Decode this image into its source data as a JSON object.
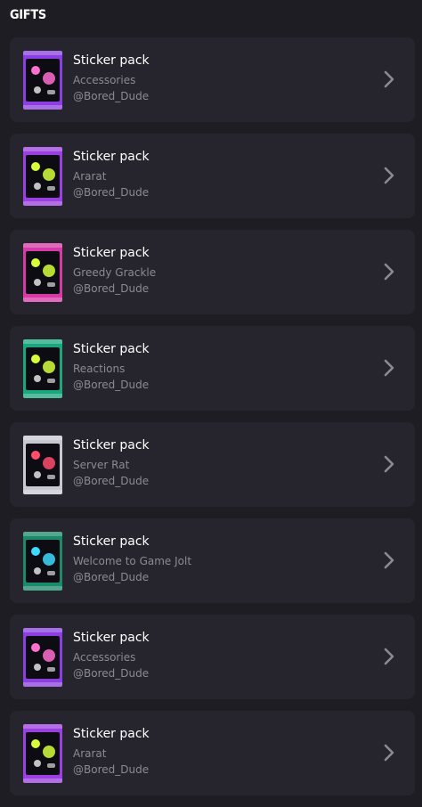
{
  "header": {
    "title": "GIFTS"
  },
  "gifts": [
    {
      "title": "Sticker pack",
      "pack": "Accessories",
      "owner": "@Bored_Dude",
      "color": "#8c3fe0",
      "accent": "#ff6fd0",
      "icon": "accessories-pack-icon"
    },
    {
      "title": "Sticker pack",
      "pack": "Ararat",
      "owner": "@Bored_Dude",
      "color": "#9b3fe0",
      "accent": "#d7ff3c",
      "icon": "ararat-pack-icon"
    },
    {
      "title": "Sticker pack",
      "pack": "Greedy Grackle",
      "owner": "@Bored_Dude",
      "color": "#d63aa7",
      "accent": "#d7ff3c",
      "icon": "greedy-grackle-pack-icon"
    },
    {
      "title": "Sticker pack",
      "pack": "Reactions",
      "owner": "@Bored_Dude",
      "color": "#1aa77d",
      "accent": "#d7ff3c",
      "icon": "reactions-pack-icon"
    },
    {
      "title": "Sticker pack",
      "pack": "Server Rat",
      "owner": "@Bored_Dude",
      "color": "#c8c8d2",
      "accent": "#ff4d6d",
      "icon": "server-rat-pack-icon"
    },
    {
      "title": "Sticker pack",
      "pack": "Welcome to Game Jolt",
      "owner": "@Bored_Dude",
      "color": "#1a8a6a",
      "accent": "#3fd8ff",
      "icon": "welcome-pack-icon"
    },
    {
      "title": "Sticker pack",
      "pack": "Accessories",
      "owner": "@Bored_Dude",
      "color": "#8c3fe0",
      "accent": "#ff6fd0",
      "icon": "accessories-pack-icon"
    },
    {
      "title": "Sticker pack",
      "pack": "Ararat",
      "owner": "@Bored_Dude",
      "color": "#9b3fe0",
      "accent": "#d7ff3c",
      "icon": "ararat-pack-icon"
    }
  ]
}
